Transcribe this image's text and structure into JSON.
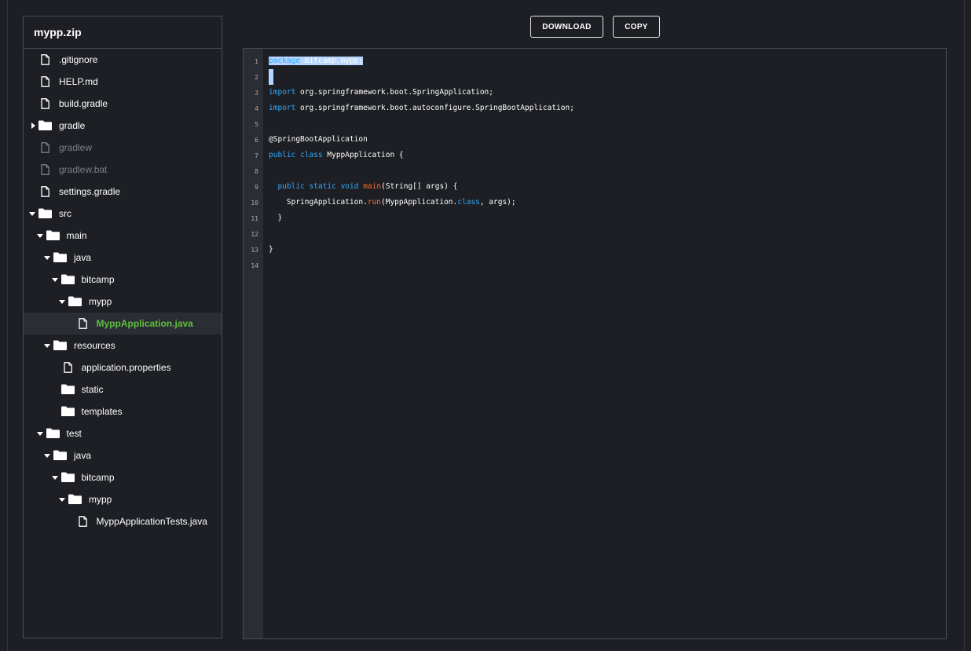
{
  "explorer": {
    "title": "mypp.zip",
    "items": [
      {
        "label": ".gitignore",
        "type": "file",
        "level": 0,
        "state": "normal"
      },
      {
        "label": "HELP.md",
        "type": "file",
        "level": 0,
        "state": "normal"
      },
      {
        "label": "build.gradle",
        "type": "file",
        "level": 0,
        "state": "normal"
      },
      {
        "label": "gradle",
        "type": "folder",
        "level": 0,
        "caret": "right",
        "state": "normal"
      },
      {
        "label": "gradlew",
        "type": "file",
        "level": 0,
        "state": "dim"
      },
      {
        "label": "gradlew.bat",
        "type": "file",
        "level": 0,
        "state": "dim"
      },
      {
        "label": "settings.gradle",
        "type": "file",
        "level": 0,
        "state": "normal"
      },
      {
        "label": "src",
        "type": "folder",
        "level": 0,
        "caret": "down",
        "state": "normal"
      },
      {
        "label": "main",
        "type": "folder",
        "level": 1,
        "caret": "down",
        "state": "normal"
      },
      {
        "label": "java",
        "type": "folder",
        "level": 2,
        "caret": "down",
        "state": "normal"
      },
      {
        "label": "bitcamp",
        "type": "folder",
        "level": 3,
        "caret": "down",
        "state": "normal"
      },
      {
        "label": "mypp",
        "type": "folder",
        "level": 4,
        "caret": "down",
        "state": "normal"
      },
      {
        "label": "MyppApplication.java",
        "type": "file",
        "level": 5,
        "state": "selected"
      },
      {
        "label": "resources",
        "type": "folder",
        "level": 2,
        "caret": "down",
        "state": "normal"
      },
      {
        "label": "application.properties",
        "type": "file",
        "level": 3,
        "state": "normal"
      },
      {
        "label": "static",
        "type": "folder",
        "level": 3,
        "state": "normal"
      },
      {
        "label": "templates",
        "type": "folder",
        "level": 3,
        "state": "normal"
      },
      {
        "label": "test",
        "type": "folder",
        "level": 1,
        "caret": "down",
        "state": "normal"
      },
      {
        "label": "java",
        "type": "folder",
        "level": 2,
        "caret": "down",
        "state": "normal"
      },
      {
        "label": "bitcamp",
        "type": "folder",
        "level": 3,
        "caret": "down",
        "state": "normal"
      },
      {
        "label": "mypp",
        "type": "folder",
        "level": 4,
        "caret": "down",
        "state": "normal"
      },
      {
        "label": "MyppApplicationTests.java",
        "type": "file",
        "level": 5,
        "state": "normal"
      }
    ]
  },
  "toolbar": {
    "download_label": "DOWNLOAD",
    "copy_label": "COPY"
  },
  "editor": {
    "line_numbers": [
      "1",
      "2",
      "3",
      "4",
      "5",
      "6",
      "7",
      "8",
      "9",
      "10",
      "11",
      "12",
      "13",
      "14"
    ],
    "lines": [
      [
        {
          "t": "package",
          "c": "kw"
        },
        {
          "t": " bitcamp.mypp;",
          "c": ""
        }
      ],
      [],
      [
        {
          "t": "import",
          "c": "kw"
        },
        {
          "t": " org.springframework.boot.SpringApplication;",
          "c": ""
        }
      ],
      [
        {
          "t": "import",
          "c": "kw"
        },
        {
          "t": " org.springframework.boot.autoconfigure.SpringBootApplication;",
          "c": ""
        }
      ],
      [],
      [
        {
          "t": "@SpringBootApplication",
          "c": ""
        }
      ],
      [
        {
          "t": "public",
          "c": "kw"
        },
        {
          "t": " ",
          "c": ""
        },
        {
          "t": "class",
          "c": "kw"
        },
        {
          "t": " MyppApplication {",
          "c": ""
        }
      ],
      [],
      [
        {
          "t": "  ",
          "c": ""
        },
        {
          "t": "public",
          "c": "kw"
        },
        {
          "t": " ",
          "c": ""
        },
        {
          "t": "static",
          "c": "kw"
        },
        {
          "t": " ",
          "c": ""
        },
        {
          "t": "void",
          "c": "kw"
        },
        {
          "t": " ",
          "c": ""
        },
        {
          "t": "main",
          "c": "fn"
        },
        {
          "t": "(String[] args) {",
          "c": ""
        }
      ],
      [
        {
          "t": "    SpringApplication.",
          "c": ""
        },
        {
          "t": "run",
          "c": "fn"
        },
        {
          "t": "(MyppApplication.",
          "c": ""
        },
        {
          "t": "class",
          "c": "kw"
        },
        {
          "t": ", args);",
          "c": ""
        }
      ],
      [
        {
          "t": "  }",
          "c": ""
        }
      ],
      [],
      [
        {
          "t": "}",
          "c": ""
        }
      ],
      []
    ]
  },
  "colors": {
    "background": "#1d1f24",
    "border": "#4a4e56",
    "keyword": "#2fa8ff",
    "function": "#ff6a2a",
    "selected_file": "#5fbf3f",
    "selection": "#b6d6ff"
  },
  "icons": {
    "file": "file-icon",
    "folder": "folder-icon",
    "expanded": "caret-down-icon",
    "collapsed": "caret-right-icon"
  }
}
